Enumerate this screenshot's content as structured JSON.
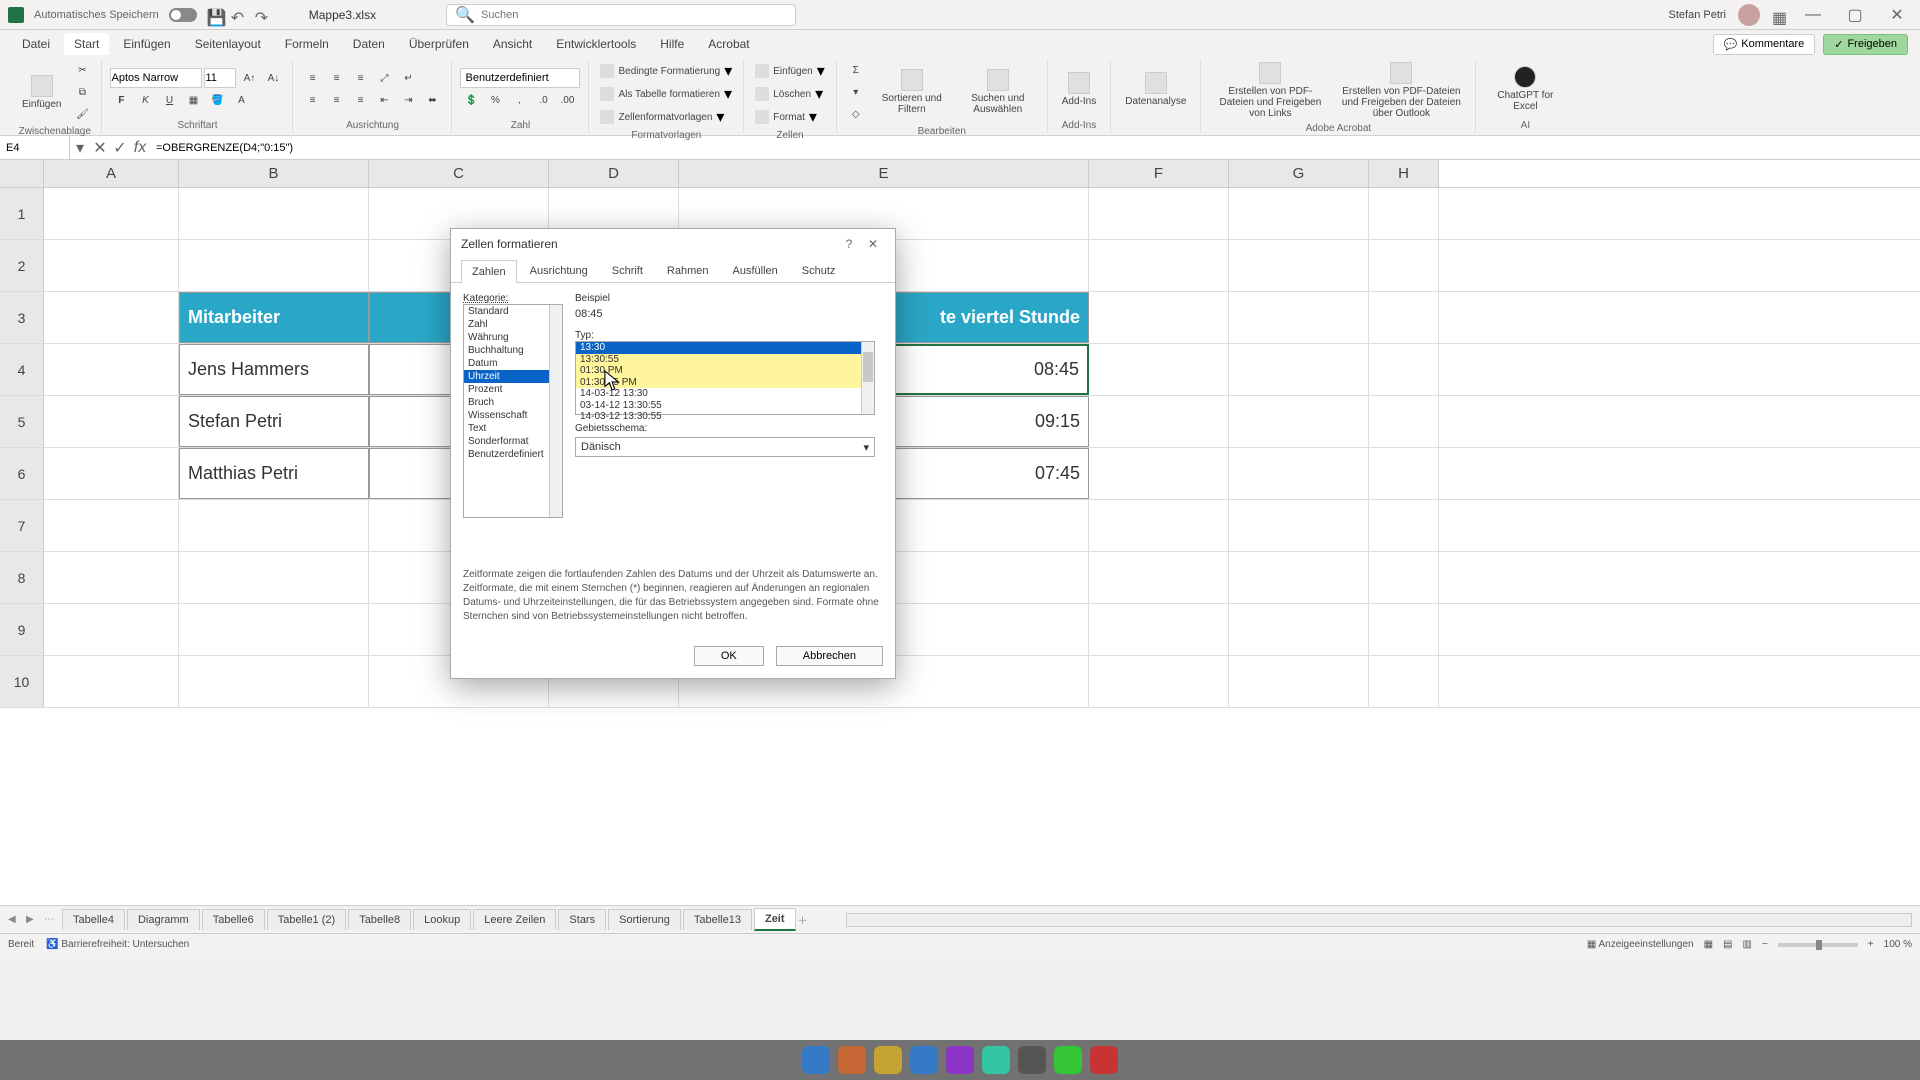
{
  "titlebar": {
    "autosave_label": "Automatisches Speichern",
    "doc_name": "Mappe3.xlsx",
    "search_placeholder": "Suchen",
    "user_name": "Stefan Petri"
  },
  "ribbon_tabs": [
    "Datei",
    "Start",
    "Einfügen",
    "Seitenlayout",
    "Formeln",
    "Daten",
    "Überprüfen",
    "Ansicht",
    "Entwicklertools",
    "Hilfe",
    "Acrobat"
  ],
  "active_ribbon_tab": "Start",
  "ribbon_right": {
    "comments": "Kommentare",
    "share": "Freigeben"
  },
  "ribbon": {
    "clipboard": {
      "paste": "Einfügen",
      "group": "Zwischenablage"
    },
    "font": {
      "name": "Aptos Narrow",
      "size": "11",
      "group": "Schriftart"
    },
    "align": {
      "group": "Ausrichtung"
    },
    "number": {
      "format": "Benutzerdefiniert",
      "group": "Zahl"
    },
    "styles": {
      "cond": "Bedingte Formatierung",
      "table": "Als Tabelle formatieren",
      "cellstyles": "Zellenformatvorlagen",
      "group": "Formatvorlagen"
    },
    "cells": {
      "insert": "Einfügen",
      "delete": "Löschen",
      "format": "Format",
      "group": "Zellen"
    },
    "editing": {
      "sort": "Sortieren und Filtern",
      "find": "Suchen und Auswählen",
      "group": "Bearbeiten"
    },
    "addins": {
      "addins": "Add-Ins",
      "group": "Add-Ins"
    },
    "analysis": {
      "label": "Datenanalyse"
    },
    "acrobat": {
      "pdf1": "Erstellen von PDF-Dateien und Freigeben von Links",
      "pdf2": "Erstellen von PDF-Dateien und Freigeben der Dateien über Outlook",
      "group": "Adobe Acrobat"
    },
    "ai": {
      "chatgpt": "ChatGPT for Excel",
      "group": "AI"
    }
  },
  "namebox": "E4",
  "formula": "=OBERGRENZE(D4;\"0:15\")",
  "columns": [
    "A",
    "B",
    "C",
    "D",
    "E",
    "F",
    "G",
    "H"
  ],
  "row_numbers": [
    "1",
    "2",
    "3",
    "4",
    "5",
    "6",
    "7",
    "8",
    "9",
    "10"
  ],
  "table": {
    "headers": {
      "b": "Mitarbeiter",
      "e": "te viertel Stunde"
    },
    "rows": [
      {
        "name": "Jens Hammers",
        "val": "08:45"
      },
      {
        "name": "Stefan Petri",
        "val": "09:15"
      },
      {
        "name": "Matthias Petri",
        "val": "07:45"
      }
    ]
  },
  "sheet_tabs": [
    "Tabelle4",
    "Diagramm",
    "Tabelle6",
    "Tabelle1 (2)",
    "Tabelle8",
    "Lookup",
    "Leere Zeilen",
    "Stars",
    "Sortierung",
    "Tabelle13",
    "Zeit"
  ],
  "active_sheet": "Zeit",
  "status": {
    "ready": "Bereit",
    "access": "Barrierefreiheit: Untersuchen",
    "display": "Anzeigeeinstellungen",
    "zoom": "100 %"
  },
  "dialog": {
    "title": "Zellen formatieren",
    "tabs": [
      "Zahlen",
      "Ausrichtung",
      "Schrift",
      "Rahmen",
      "Ausfüllen",
      "Schutz"
    ],
    "active_tab": "Zahlen",
    "category_label": "Kategorie:",
    "categories": [
      "Standard",
      "Zahl",
      "Währung",
      "Buchhaltung",
      "Datum",
      "Uhrzeit",
      "Prozent",
      "Bruch",
      "Wissenschaft",
      "Text",
      "Sonderformat",
      "Benutzerdefiniert"
    ],
    "selected_category": "Uhrzeit",
    "sample_label": "Beispiel",
    "sample_value": "08:45",
    "type_label": "Typ:",
    "types": [
      "13:30",
      "13:30:55",
      "01:30 PM",
      "01:30:55 PM",
      "14-03-12 13:30",
      "03-14-12 13:30:55",
      "14-03-12 13:30:55"
    ],
    "selected_type_index": 0,
    "highlighted_type_indices": [
      1,
      2,
      3
    ],
    "locale_label": "Gebietsschema:",
    "locale_value": "Dänisch",
    "description": "Zeitformate zeigen die fortlaufenden Zahlen des Datums und der Uhrzeit als Datumswerte an. Zeitformate, die mit einem Sternchen (*) beginnen, reagieren auf Änderungen an regionalen Datums- und Uhrzeiteinstellungen, die für das Betriebssystem angegeben sind. Formate ohne Sternchen sind von Betriebssystemeinstellungen nicht betroffen.",
    "ok": "OK",
    "cancel": "Abbrechen"
  }
}
